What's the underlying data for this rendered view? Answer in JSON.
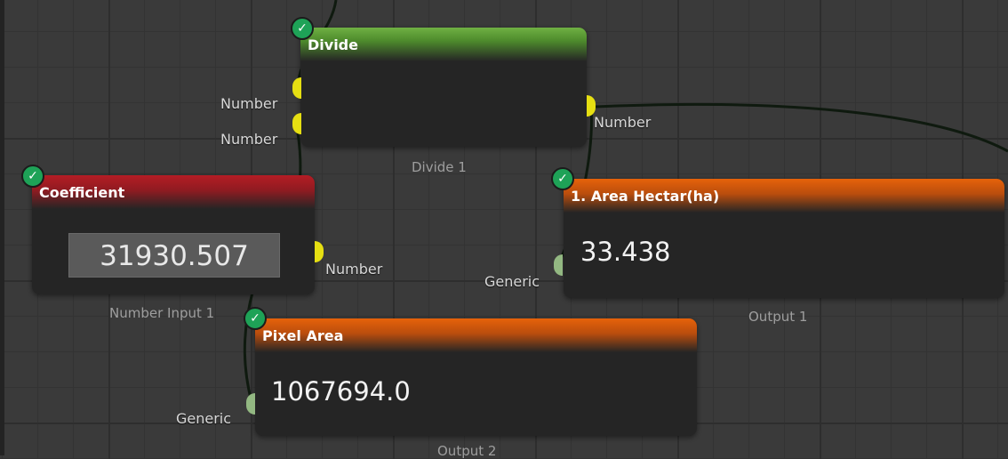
{
  "nodes": {
    "divide": {
      "title": "Divide",
      "caption": "Divide 1",
      "inputs": [
        "Number",
        "Number"
      ],
      "output": "Number",
      "header_color": "#5a9a36",
      "status_icon": "check-icon"
    },
    "coefficient": {
      "title": "Coefficient",
      "caption": "Number Input 1",
      "value": "31930.507",
      "output": "Number",
      "header_color": "#a51c23",
      "status_icon": "check-icon"
    },
    "area_hectar": {
      "title": "1. Area Hectar(ha)",
      "caption": "Output 1",
      "value": "33.438",
      "input": "Generic",
      "header_color": "#d2580b",
      "status_icon": "check-icon"
    },
    "pixel_area": {
      "title": "Pixel Area",
      "caption": "Output 2",
      "value": "1067694.0",
      "input": "Generic",
      "header_color": "#d2580b",
      "status_icon": "check-icon"
    }
  },
  "colors": {
    "port_number": "#e6df12",
    "port_generic": "#93b882",
    "canvas_bg": "#3a3a3a",
    "node_bg": "#252525",
    "wire": "#0f1a0f"
  }
}
